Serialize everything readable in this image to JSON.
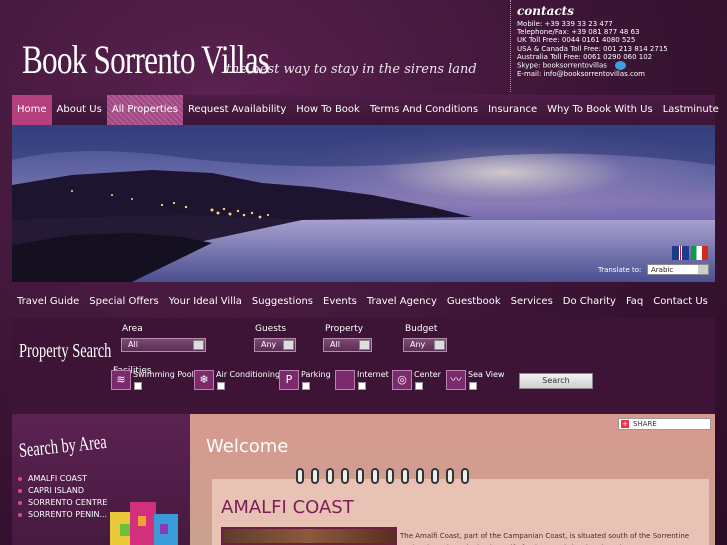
{
  "header": {
    "title": "Book Sorrento Villas",
    "tagline": "the best way to stay in the sirens land"
  },
  "contacts": {
    "title": "contacts",
    "lines": [
      "Mobile: +39 339 33 23 477",
      "Telephone/Fax: +39 081 877 48 63",
      "UK Toll Free: 0044 0161 4080 525",
      "USA & Canada Toll Free: 001 213 814 2715",
      "Australia Toll Free: 0061 0290 060 102",
      "Skype: booksorrentovillas",
      "E-mail: info@booksorrentovillas.com"
    ]
  },
  "topnav": [
    "Home",
    "About Us",
    "All Properties",
    "Request Availability",
    "How To Book",
    "Terms And Conditions",
    "Insurance",
    "Why To Book With Us",
    "Lastminute"
  ],
  "translate": {
    "label": "Translate to:",
    "selected": "Arabic"
  },
  "subnav": [
    "Travel Guide",
    "Special Offers",
    "Your Ideal Villa",
    "Suggestions",
    "Events",
    "Travel Agency",
    "Guestbook",
    "Services",
    "Do Charity",
    "Faq",
    "Contact Us"
  ],
  "search": {
    "title": "Property Search",
    "fields": [
      {
        "label": "Area",
        "value": "All"
      },
      {
        "label": "Guests",
        "value": "Any"
      },
      {
        "label": "Property",
        "value": "All"
      },
      {
        "label": "Budget",
        "value": "Any"
      }
    ],
    "facilities_label": "Facilities",
    "facilities": [
      "Swimming Pool",
      "Air Conditioning",
      "Parking",
      "Internet",
      "Center",
      "Sea View"
    ],
    "button": "Search"
  },
  "sidebar": {
    "title": "Search by Area",
    "areas": [
      "AMALFI COAST",
      "CAPRI ISLAND",
      "SORRENTO CENTRE",
      "SORRENTO PENIN..."
    ]
  },
  "main": {
    "share_label": "SHARE",
    "welcome": "Welcome",
    "card_title": "AMALFI COAST",
    "card_text": "The Amalfi Coast, part of the Campanian Coast, is situated south of the Sorrentine Peninsula and overlooks the Gulf of Salerno. It is bordered on the"
  }
}
